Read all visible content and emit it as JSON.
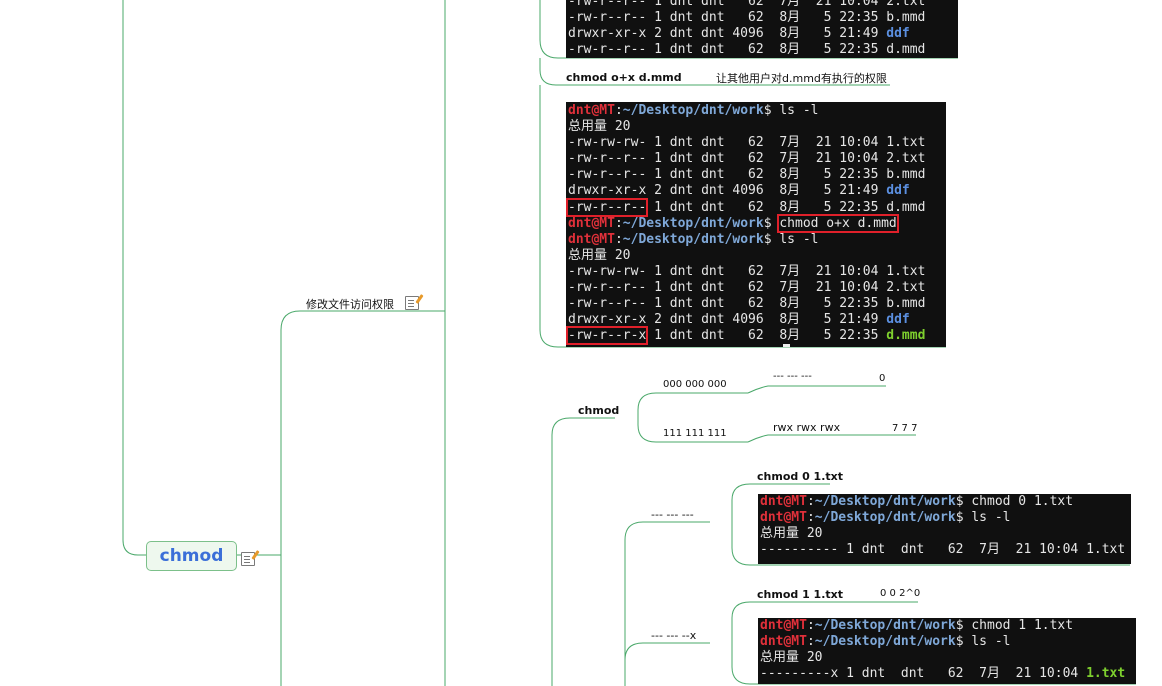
{
  "center_node": {
    "label": "chmod"
  },
  "branch_modify": {
    "label": "修改文件访问权限"
  },
  "example_o_plus_x": {
    "command_label": "chmod o+x d.mmd",
    "description": "让其他用户对d.mmd有执行的权限"
  },
  "terminal_top": {
    "lines": [
      "-rw-r--r-- 1 dnt dnt   62  8月   5 22:35 b.mmd",
      "drwxr-xr-x 2 dnt dnt 4096  8月   5 21:49 ",
      "-rw-r--r-- 1 dnt dnt   62  8月   5 22:35 d.mmd",
      "           ..."
    ],
    "dir_name": "ddf"
  },
  "terminal_main": {
    "user": "dnt@MT",
    "path": "~/Desktop/dnt/work",
    "cmd_ls": "ls -l",
    "cmd_chmod": "chmod o+x d.mmd",
    "total": "总用量 20",
    "listing1": [
      {
        "perm": "-rw-rw-rw-",
        "rest": " 1 dnt dnt   62  7月  21 10:04 ",
        "name": "1.txt"
      },
      {
        "perm": "-rw-r--r--",
        "rest": " 1 dnt dnt   62  7月  21 10:04 ",
        "name": "2.txt"
      },
      {
        "perm": "-rw-r--r--",
        "rest": " 1 dnt dnt   62  8月   5 22:35 ",
        "name": "b.mmd"
      },
      {
        "perm": "drwxr-xr-x",
        "rest": " 2 dnt dnt 4096  8月   5 21:49 ",
        "name": "ddf"
      },
      {
        "perm": "-rw-r--r--",
        "rest": " 1 dnt dnt   62  8月   5 22:35 ",
        "name": "d.mmd"
      }
    ],
    "listing2": [
      {
        "perm": "-rw-rw-rw-",
        "rest": " 1 dnt dnt   62  7月  21 10:04 ",
        "name": "1.txt"
      },
      {
        "perm": "-rw-r--r--",
        "rest": " 1 dnt dnt   62  7月  21 10:04 ",
        "name": "2.txt"
      },
      {
        "perm": "-rw-r--r--",
        "rest": " 1 dnt dnt   62  8月   5 22:35 ",
        "name": "b.mmd"
      },
      {
        "perm": "drwxr-xr-x",
        "rest": " 2 dnt dnt 4096  8月   5 21:49 ",
        "name": "ddf"
      },
      {
        "perm": "-rw-r--r-x",
        "rest": " 1 dnt dnt   62  8月   5 22:35 ",
        "name": "d.mmd"
      }
    ]
  },
  "chmod_numeric": {
    "label": "chmod",
    "binary_zero": "000 000 000",
    "perm_zero": "--- --- ---",
    "value_zero": "0",
    "binary_full": "111 111 111",
    "perm_full": "rwx rwx rwx",
    "value_full": "7 7 7"
  },
  "example_chmod0": {
    "branch": "--- --- ---",
    "command_label": "chmod 0 1.txt",
    "terminal": {
      "cmd1": "chmod 0 1.txt",
      "cmd2": "ls -l",
      "total": "总用量 20",
      "row": "---------- 1 dnt  dnt   62  7月  21 10:04 1.txt"
    }
  },
  "example_chmod1": {
    "branch": "--- --- --x",
    "command_label": "chmod 1 1.txt",
    "value": "0 0 2^0",
    "terminal": {
      "cmd1": "chmod 1 1.txt",
      "cmd2": "ls -l",
      "total": "总用量 20",
      "row_rest": "---------x 1 dnt  dnt   62  7月  21 10:04 ",
      "row_name": "1.txt"
    }
  }
}
